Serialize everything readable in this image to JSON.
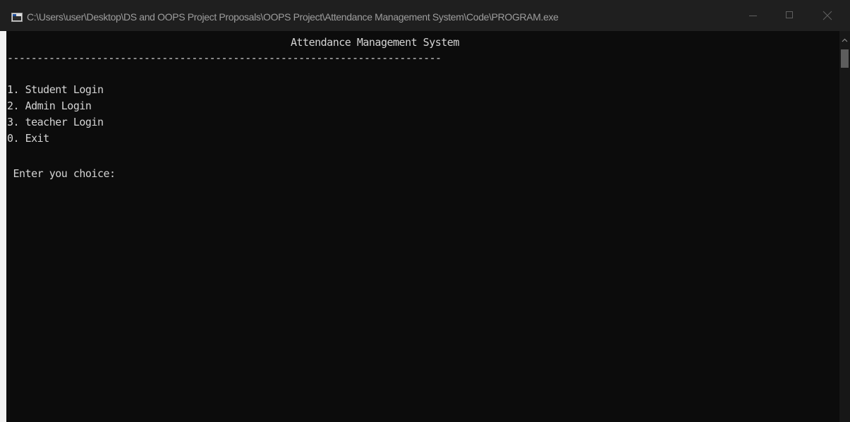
{
  "window": {
    "title": "C:\\Users\\user\\Desktop\\DS and OOPS Project  Proposals\\OOPS Project\\Attendance Management System\\Code\\PROGRAM.exe",
    "icons": {
      "app": "console-app-icon",
      "minimize": "minimize-icon",
      "maximize": "maximize-icon",
      "close": "close-icon",
      "scroll_up": "chevron-up-icon"
    },
    "colors": {
      "background": "#0c0c0c",
      "text": "#d4d4d4",
      "titlebar": "#1f1f1f"
    }
  },
  "console": {
    "header": "Attendance Management System",
    "separator": "-------------------------------------------------------------------------",
    "menu_items": [
      "1. Student Login",
      "2. Admin Login",
      "3. teacher Login",
      "0. Exit"
    ],
    "prompt": " Enter you choice:"
  }
}
